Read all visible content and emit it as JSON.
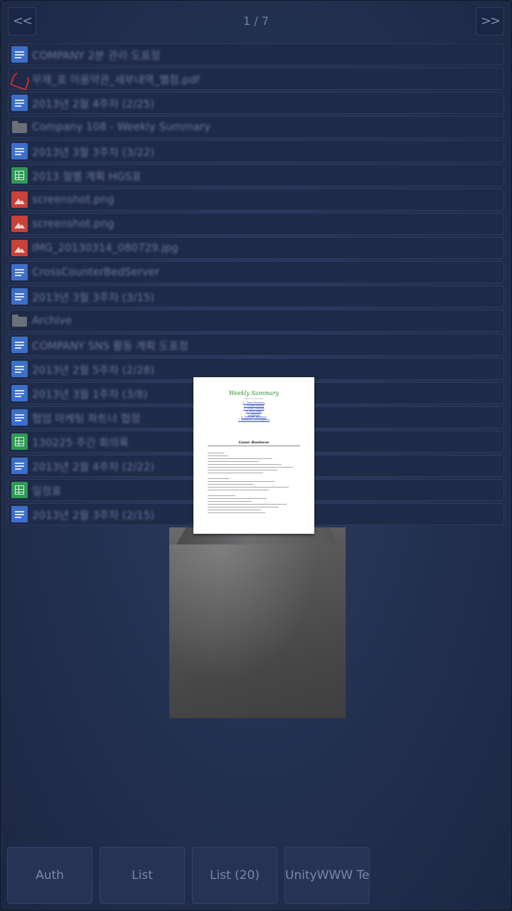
{
  "nav": {
    "prev_label": "<<",
    "next_label": ">>",
    "page_counter": "1 / 7"
  },
  "files": [
    {
      "icon": "doc-icon",
      "name": "COMPANY 2분 관리 도표정"
    },
    {
      "icon": "pdf-icon",
      "name": "무제_표 이용약관_세부내역_별첨.pdf"
    },
    {
      "icon": "doc-icon",
      "name": "2013년 2월 4주차 (2/25)"
    },
    {
      "icon": "folder-icon",
      "name": "Company 108 - Weekly Summary"
    },
    {
      "icon": "doc-icon",
      "name": "2013년 3월 3주차 (3/22)"
    },
    {
      "icon": "sheet-icon",
      "name": "2013 월별 계획 HGS표"
    },
    {
      "icon": "image-icon",
      "name": "screenshot.png"
    },
    {
      "icon": "image-icon",
      "name": "screenshot.png"
    },
    {
      "icon": "image-icon",
      "name": "IMG_20130314_080729.jpg"
    },
    {
      "icon": "doc-icon",
      "name": "CrossCounterBedServer"
    },
    {
      "icon": "doc-icon",
      "name": "2013년 3월 3주차 (3/15)"
    },
    {
      "icon": "folder-icon",
      "name": "Archive"
    },
    {
      "icon": "doc-icon",
      "name": "COMPANY SNS 활동 계획 도표정"
    },
    {
      "icon": "doc-icon",
      "name": "2013년 2월 5주차 (2/28)"
    },
    {
      "icon": "doc-icon",
      "name": "2013년 3월 1주차 (3/8)"
    },
    {
      "icon": "doc-icon",
      "name": "협업 마케팅 파트너 협정"
    },
    {
      "icon": "sheet-icon",
      "name": "130225 주간 회의록"
    },
    {
      "icon": "doc-icon",
      "name": "2013년 2월 4주차 (2/22)"
    },
    {
      "icon": "sheet-icon",
      "name": "일정표"
    },
    {
      "icon": "doc-icon",
      "name": "2013년 2월 3주차 (2/15)"
    }
  ],
  "preview": {
    "title": "Weekly Summary",
    "subtitle": "Table of contents",
    "toc": [
      "1. Game Business",
      "2. Mobile Result",
      "3. Cross Counter",
      "4. Tech Stats",
      "5. Service",
      "6. Platform Business",
      "7. Research Development"
    ],
    "section_heading": "Game Business"
  },
  "bottom_buttons": [
    {
      "name": "auth-button",
      "label": "Auth"
    },
    {
      "name": "list-button",
      "label": "List"
    },
    {
      "name": "list-20-button",
      "label": "List (20)"
    },
    {
      "name": "unitywww-test-button",
      "label": "UnityWWW Test"
    }
  ]
}
